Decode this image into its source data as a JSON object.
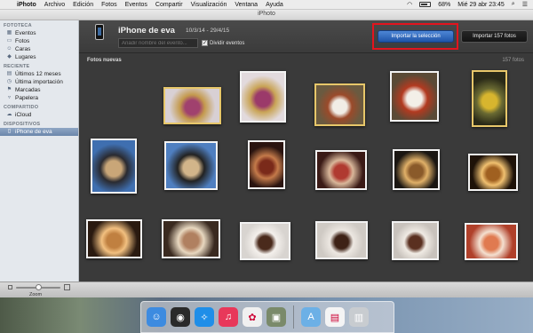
{
  "menubar": {
    "apple_icon": "apple-icon",
    "items": [
      "iPhoto",
      "Archivo",
      "Edición",
      "Fotos",
      "Eventos",
      "Compartir",
      "Visualización",
      "Ventana",
      "Ayuda"
    ],
    "battery": "68%",
    "clock": "Mié 29 abr  23:45"
  },
  "window": {
    "title": "iPhoto"
  },
  "sidebar": {
    "sections": [
      {
        "header": "FOTOTECA",
        "items": [
          {
            "label": "Eventos",
            "icon": "events-icon"
          },
          {
            "label": "Fotos",
            "icon": "photos-icon"
          },
          {
            "label": "Caras",
            "icon": "faces-icon"
          },
          {
            "label": "Lugares",
            "icon": "places-icon"
          }
        ]
      },
      {
        "header": "RECIENTE",
        "items": [
          {
            "label": "Últimos 12 meses",
            "icon": "calendar-icon"
          },
          {
            "label": "Última importación",
            "icon": "clock-icon"
          },
          {
            "label": "Marcadas",
            "icon": "flag-icon"
          },
          {
            "label": "Papelera",
            "icon": "trash-icon"
          }
        ]
      },
      {
        "header": "COMPARTIDO",
        "items": [
          {
            "label": "iCloud",
            "icon": "cloud-icon"
          }
        ]
      },
      {
        "header": "DISPOSITIVOS",
        "items": [
          {
            "label": "iPhone de eva",
            "icon": "iphone-icon",
            "active": true
          }
        ]
      }
    ]
  },
  "import": {
    "device_name": "iPhone de eva",
    "date_range": "10/3/14 - 29/4/15",
    "event_name_placeholder": "Añadir nombre del evento...",
    "split_events_label": "Dividir eventos",
    "split_events_checked": true,
    "import_selection_button": "Importar la selección",
    "import_all_button": "Importar 157 fotos",
    "section_label": "Fotos nuevas",
    "photo_count": "157 fotos"
  },
  "photos": [
    {
      "subject": "food-plate-figs",
      "selected": true,
      "colors": [
        "#d8d0d4",
        "#a0416e",
        "#c49a4d"
      ]
    },
    {
      "subject": "food-plate-figs",
      "selected": false,
      "colors": [
        "#e2dadd",
        "#9b3a6a",
        "#c9a456"
      ]
    },
    {
      "subject": "dish-plate",
      "selected": true,
      "colors": [
        "#6a5a40",
        "#f1ede6",
        "#9b4a2a"
      ]
    },
    {
      "subject": "dish-plate",
      "selected": false,
      "colors": [
        "#5a4a36",
        "#f3efe8",
        "#b23a20"
      ]
    },
    {
      "subject": "yellow-flowers",
      "selected": true,
      "colors": [
        "#2a2a18",
        "#d7b52e",
        "#6a6a32"
      ]
    },
    {
      "subject": "beach-people",
      "selected": false,
      "colors": [
        "#3f6fb0",
        "#c9a678",
        "#2a2a30"
      ]
    },
    {
      "subject": "beach-people",
      "selected": false,
      "colors": [
        "#4f7fc0",
        "#d2b58a",
        "#222"
      ]
    },
    {
      "subject": "dark-restaurant",
      "selected": false,
      "colors": [
        "#2a1410",
        "#7a2a1a",
        "#c47a4a"
      ]
    },
    {
      "subject": "food-table",
      "selected": false,
      "colors": [
        "#3a1a16",
        "#b03a30",
        "#d9b79a"
      ]
    },
    {
      "subject": "interior-lamp",
      "selected": false,
      "colors": [
        "#1a1612",
        "#8a5a2a",
        "#e0b068"
      ]
    },
    {
      "subject": "fireplace-room",
      "selected": false,
      "colors": [
        "#1e1208",
        "#a06020",
        "#f0c070"
      ]
    },
    {
      "subject": "restaurant-interior",
      "selected": false,
      "colors": [
        "#2a1a10",
        "#c08040",
        "#f2c080"
      ]
    },
    {
      "subject": "restaurant-hall",
      "selected": false,
      "colors": [
        "#3a2a20",
        "#b08060",
        "#e8d8c0"
      ]
    },
    {
      "subject": "dessert-plate",
      "selected": false,
      "colors": [
        "#d8d4d0",
        "#4a2a1c",
        "#f4f0ec"
      ]
    },
    {
      "subject": "dessert-plate",
      "selected": false,
      "colors": [
        "#cfcac4",
        "#3e2216",
        "#ede8e2"
      ]
    },
    {
      "subject": "dessert-slice",
      "selected": false,
      "colors": [
        "#c8c2bc",
        "#5a3020",
        "#f0ebe4"
      ]
    },
    {
      "subject": "menu-card",
      "selected": false,
      "colors": [
        "#b0402a",
        "#e07a50",
        "#f4e0d0"
      ]
    }
  ],
  "bottombar": {
    "zoom_label": "Zoom"
  },
  "dock": {
    "icons": [
      "finder-icon",
      "dashboard-icon",
      "safari-icon",
      "itunes-icon",
      "photos-icon",
      "preview-icon",
      "applications-folder-icon",
      "document-icon",
      "trash-icon"
    ],
    "colors": [
      "#3d8be0",
      "#2a2a2a",
      "#1f8ee8",
      "#e8385a",
      "#f0f0f0",
      "#7a8a6a",
      "#6cb0e6",
      "#f4f4f4",
      "#c8ccd0"
    ]
  }
}
